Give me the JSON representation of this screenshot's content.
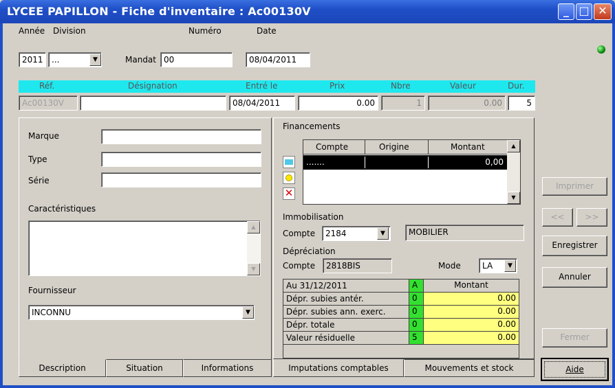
{
  "window": {
    "title": "LYCEE PAPILLON - Fiche d'inventaire : Ac00130V"
  },
  "header": {
    "annee_label": "Année",
    "division_label": "Division",
    "numero_label": "Numéro",
    "date_label": "Date",
    "annee_value": "2011",
    "division_value": "...",
    "mandat_label": "Mandat",
    "mandat_value": "00",
    "date_value": "08/04/2011"
  },
  "grid_header": {
    "ref": "Réf.",
    "designation": "Désignation",
    "entre_le": "Entré le",
    "prix": "Prix",
    "nbre": "Nbre",
    "valeur": "Valeur",
    "dur": "Dur."
  },
  "grid_row": {
    "ref": "Ac00130V",
    "designation": "",
    "entre_le": "08/04/2011",
    "prix": "0.00",
    "nbre": "1",
    "valeur": "0.00",
    "dur": "5"
  },
  "description": {
    "marque_label": "Marque",
    "type_label": "Type",
    "serie_label": "Série",
    "caracteristiques_label": "Caractéristiques",
    "fournisseur_label": "Fournisseur",
    "fournisseur_value": "INCONNU"
  },
  "left_tabs": [
    "Description",
    "Situation",
    "Informations"
  ],
  "financements": {
    "label": "Financements",
    "columns": [
      "Compte",
      "Origine",
      "Montant"
    ],
    "row": {
      "compte": ".......",
      "origine": "",
      "montant": "0,00"
    }
  },
  "immobilisation": {
    "label": "Immobilisation",
    "compte_label": "Compte",
    "compte_value": "2184",
    "compte_desc": "MOBILIER"
  },
  "depreciation": {
    "label": "Dépréciation",
    "compte_label": "Compte",
    "compte_value": "2818BIS",
    "mode_label": "Mode",
    "mode_value": "LA",
    "table_header": {
      "date": "Au 31/12/2011",
      "a": "A",
      "montant": "Montant"
    },
    "rows": [
      {
        "label": "Dépr. subies antér.",
        "a": "0",
        "montant": "0.00"
      },
      {
        "label": "Dépr. subies ann. exerc.",
        "a": "0",
        "montant": "0.00"
      },
      {
        "label": "Dépr. totale",
        "a": "0",
        "montant": "0.00"
      },
      {
        "label": "Valeur résiduelle",
        "a": "5",
        "montant": "0.00"
      }
    ]
  },
  "right_tabs": [
    "Imputations comptables",
    "Mouvements et stock"
  ],
  "actions": {
    "imprimer": "Imprimer",
    "prev": "<<",
    "next": ">>",
    "enregistrer": "Enregistrer",
    "annuler": "Annuler",
    "fermer": "Fermer",
    "aide": "Aide"
  },
  "colors": {
    "titlebar": "#1f4fc7",
    "header_bar": "#1ee8ee",
    "amount_fill": "#ffff80",
    "a_fill": "#33e030",
    "led": "#0a8a0a"
  }
}
